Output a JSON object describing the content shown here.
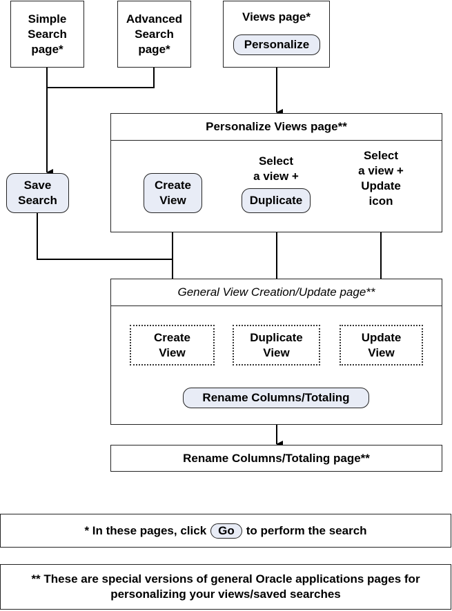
{
  "top": {
    "simple_search": "Simple\nSearch\npage*",
    "advanced_search": "Advanced\nSearch\npage*",
    "views_page": "Views page*",
    "personalize_button": "Personalize"
  },
  "save_search_button": "Save\nSearch",
  "personalize_views": {
    "title": "Personalize Views page**",
    "create_view_button": "Create\nView",
    "select_view_text": "Select\na view +",
    "duplicate_button": "Duplicate",
    "select_update_text": "Select\na view +\nUpdate\nicon"
  },
  "general_view": {
    "title": "General View Creation/Update page**",
    "create_view": "Create\nView",
    "duplicate_view": "Duplicate\nView",
    "update_view": "Update\nView",
    "rename_button": "Rename Columns/Totaling"
  },
  "rename_page": "Rename Columns/Totaling page**",
  "notes": {
    "note1_before": "* In these pages, click",
    "note1_go": "Go",
    "note1_after": "to perform the search",
    "note2": "** These are special versions of general Oracle applications pages for\npersonalizing your views/saved searches"
  }
}
